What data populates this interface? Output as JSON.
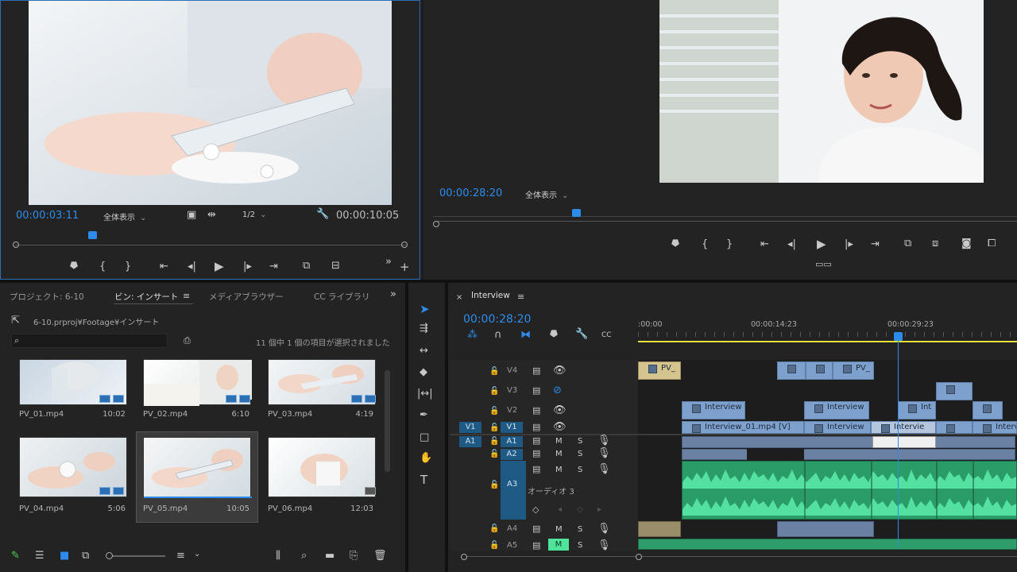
{
  "source_monitor": {
    "timecode_current": "00:00:03:11",
    "zoom_label": "全体表示",
    "resolution_label": "1/2",
    "timecode_duration": "00:00:10:05",
    "playhead_fraction": 0.19
  },
  "program_monitor": {
    "timecode_current": "00:00:28:20",
    "zoom_label": "全体表示",
    "playhead_fraction": 0.24
  },
  "project_panel": {
    "tabs": [
      "プロジェクト: 6-10",
      "ビン: インサート",
      "メディアブラウザー",
      "CC ライブラリ"
    ],
    "path": "6-10.prproj¥Footage¥インサート",
    "selection_status": "11 個中 1 個の項目が選択されました",
    "search_placeholder": "",
    "items": [
      {
        "name": "PV_01.mp4",
        "duration": "10:02"
      },
      {
        "name": "PV_02.mp4",
        "duration": "6:10"
      },
      {
        "name": "PV_03.mp4",
        "duration": "4:19"
      },
      {
        "name": "PV_04.mp4",
        "duration": "5:06"
      },
      {
        "name": "PV_05.mp4",
        "duration": "10:05"
      },
      {
        "name": "PV_06.mp4",
        "duration": "12:03"
      }
    ]
  },
  "timeline": {
    "sequence_name": "Interview",
    "timecode": "00:00:28:20",
    "ruler": [
      ":00:00",
      "00:00:14:23",
      "00:00:29:23"
    ],
    "tracks_video": [
      {
        "name": "V4"
      },
      {
        "name": "V3"
      },
      {
        "name": "V2"
      },
      {
        "name": "V1"
      }
    ],
    "tracks_audio": [
      {
        "name": "A1"
      },
      {
        "name": "A2"
      },
      {
        "name": "A3",
        "label": "オーディオ 3"
      },
      {
        "name": "A4"
      },
      {
        "name": "A5"
      }
    ],
    "source_patch_v": "V1",
    "source_patch_a": "A1",
    "mute_label": "M",
    "solo_label": "S",
    "clips": {
      "v4_a": "PV_",
      "v4_b": "PV_",
      "v2_a": "Interview",
      "v2_b": "Interview",
      "v2_c": "Int",
      "v1_a": "Interview_01.mp4 [V]",
      "v1_b": "Interview",
      "v1_c": "Intervie",
      "v1_d": "Interv"
    }
  },
  "colors": {
    "accent": "#2d8ceb",
    "video_clip": "#7ea0cc",
    "audio_clip": "#2a9c67",
    "yellow_bar": "#e8e23a"
  }
}
